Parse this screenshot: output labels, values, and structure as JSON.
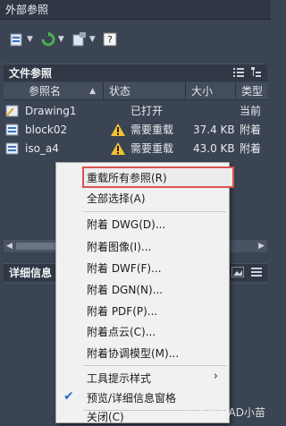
{
  "window": {
    "title": "外部参照"
  },
  "toolbar": {
    "buttons": [
      {
        "icon": "attach-dwg-icon",
        "has_dropdown": true
      },
      {
        "icon": "refresh-icon",
        "has_dropdown": true
      },
      {
        "icon": "change-path-icon",
        "has_dropdown": true
      },
      {
        "icon": "help-icon",
        "has_dropdown": false
      }
    ]
  },
  "file_refs": {
    "title": "文件参照",
    "columns": [
      "参照名",
      "状态",
      "大小",
      "类型"
    ],
    "rows": [
      {
        "name": "Drawing1",
        "status": "已打开",
        "size": "",
        "type": "当前",
        "icon": "drawing-icon",
        "warning": false
      },
      {
        "name": "block02",
        "status": "需要重载",
        "size": "37.4 KB",
        "type": "附着",
        "icon": "dwg-file-icon",
        "warning": true
      },
      {
        "name": "iso_a4",
        "status": "需要重载",
        "size": "43.0 KB",
        "type": "附着",
        "icon": "dwg-file-icon",
        "warning": true
      }
    ]
  },
  "details": {
    "title": "详细信息"
  },
  "context_menu": {
    "items": [
      {
        "label": "重载所有参照(R)",
        "highlighted": true
      },
      {
        "label": "全部选择(A)"
      },
      {
        "label": "附着 DWG(D)..."
      },
      {
        "label": "附着图像(I)..."
      },
      {
        "label": "附着 DWF(F)..."
      },
      {
        "label": "附着 DGN(N)..."
      },
      {
        "label": "附着 PDF(P)..."
      },
      {
        "label": "附着点云(C)..."
      },
      {
        "label": "附着协调模型(M)..."
      },
      {
        "label": "工具提示样式",
        "submenu": true
      },
      {
        "label": "预览/详细信息窗格",
        "checked": true
      },
      {
        "label": "关闭(C)"
      }
    ]
  },
  "watermark": "头条号/CAD小苗",
  "colors": {
    "panel": "#3b4453",
    "menu_bg": "#f1f1f1",
    "highlight_border": "#d9534f",
    "warning": "#f2c230"
  }
}
